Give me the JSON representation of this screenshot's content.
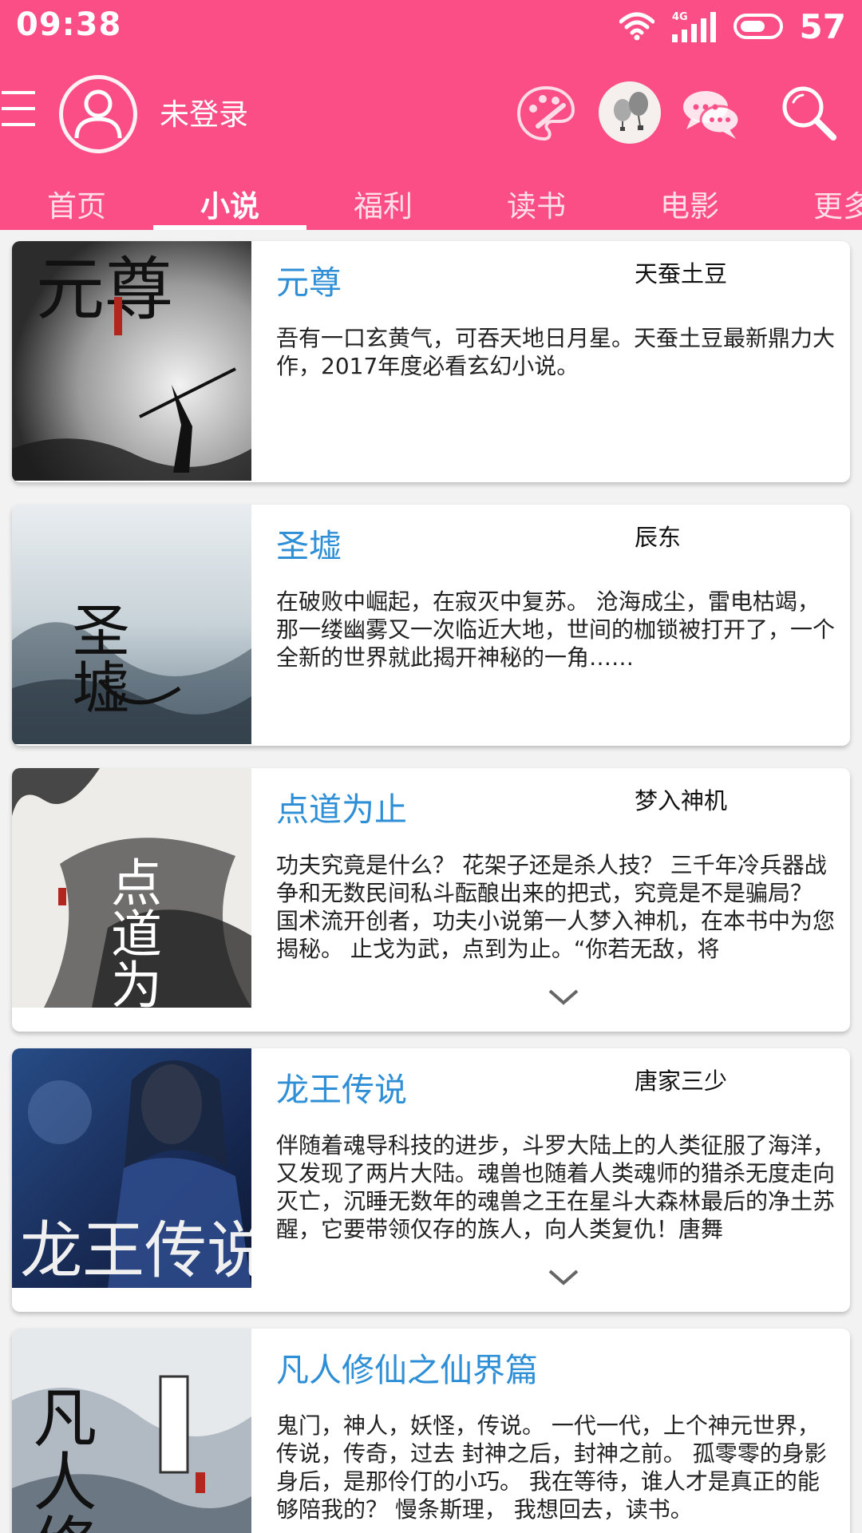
{
  "status_bar": {
    "time": "09:38",
    "network": "4G",
    "battery": "57"
  },
  "toolbar": {
    "login_text": "未登录",
    "icons": [
      "menu-icon",
      "avatar-icon",
      "palette-icon",
      "balloon-icon",
      "chat-icon",
      "search-icon"
    ]
  },
  "tabs": [
    {
      "label": "首页",
      "active": false
    },
    {
      "label": "小说",
      "active": true
    },
    {
      "label": "福利",
      "active": false
    },
    {
      "label": "读书",
      "active": false
    },
    {
      "label": "电影",
      "active": false
    },
    {
      "label": "更多",
      "active": false
    }
  ],
  "books": [
    {
      "title": "元尊",
      "author": "天蚕土豆",
      "description": "吾有一口玄黄气，可吞天地日月星。天蚕土豆最新鼎力大作，2017年度必看玄幻小说。",
      "cover_text": "元尊",
      "expandable": false
    },
    {
      "title": "圣墟",
      "author": "辰东",
      "description": "在破败中崛起，在寂灭中复苏。 沧海成尘，雷电枯竭，那一缕幽雾又一次临近大地，世间的枷锁被打开了，一个全新的世界就此揭开神秘的一角……",
      "cover_text": "圣墟",
      "expandable": false
    },
    {
      "title": "点道为止",
      "author": "梦入神机",
      "description": "功夫究竟是什么？ 花架子还是杀人技？ 三千年冷兵器战争和无数民间私斗酝酿出来的把式，究竟是不是骗局？ 国术流开创者，功夫小说第一人梦入神机，在本书中为您揭秘。 止戈为武，点到为止。“你若无敌，将",
      "cover_text": "点道为止",
      "expandable": true
    },
    {
      "title": "龙王传说",
      "author": "唐家三少",
      "description": "伴随着魂导科技的进步，斗罗大陆上的人类征服了海洋，又发现了两片大陆。魂兽也随着人类魂师的猎杀无度走向灭亡，沉睡无数年的魂兽之王在星斗大森林最后的净土苏醒，它要带领仅存的族人，向人类复仇！唐舞",
      "cover_text": "龙王传说",
      "expandable": true
    },
    {
      "title": "凡人修仙之仙界篇",
      "author": "",
      "description": "鬼门，神人，妖怪，传说。 一代一代，上个神元世界，传说，传奇，过去 封神之后，封神之前。 孤零零的身影身后，是那伶仃的小巧。 我在等待，谁人才是真正的能够陪我的？ 慢条斯理， 我想回去，读书。",
      "cover_text": "凡人修",
      "expandable": false
    }
  ],
  "colors": {
    "header_bg": "#fb4e86",
    "title_blue": "#2e8fd6"
  }
}
